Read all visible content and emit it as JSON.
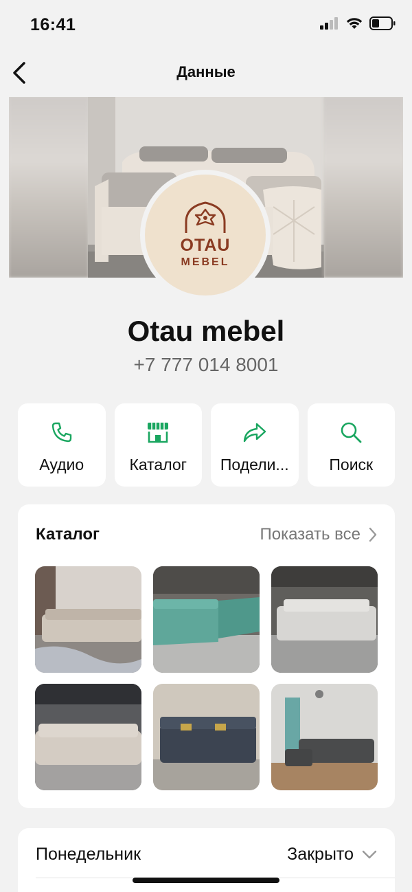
{
  "status_bar": {
    "time": "16:41"
  },
  "nav": {
    "title": "Данные"
  },
  "logo": {
    "line1": "OTAU",
    "line2": "MEBEL"
  },
  "business": {
    "name": "Otau mebel",
    "phone": "+7 777 014 8001"
  },
  "actions": [
    {
      "label": "Аудио",
      "icon": "phone-icon"
    },
    {
      "label": "Каталог",
      "icon": "storefront-icon"
    },
    {
      "label": "Подели...",
      "icon": "share-icon"
    },
    {
      "label": "Поиск",
      "icon": "search-icon"
    }
  ],
  "catalog": {
    "title": "Каталог",
    "show_all": "Показать все"
  },
  "hours": {
    "day": "Понедельник",
    "status": "Закрыто"
  },
  "colors": {
    "accent": "#1aa660",
    "logo_brown": "#8a3b22"
  }
}
